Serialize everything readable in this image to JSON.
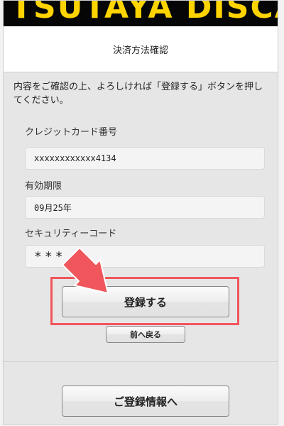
{
  "header": {
    "logo_text": "TSUTAYA DISCAS",
    "page_title": "決済方法確認"
  },
  "notice": "内容をご確認の上、よろしければ「登録する」ボタンを押してください。",
  "form": {
    "card_number_label": "クレジットカード番号",
    "card_number_value": "xxxxxxxxxxxx4134",
    "expiry_label": "有効期限",
    "expiry_value": "09月25年",
    "security_code_label": "セキュリティーコード",
    "security_code_value": "***"
  },
  "buttons": {
    "register": "登録する",
    "back": "前へ戻る",
    "registration_info": "ご登録情報へ"
  },
  "annotation": {
    "highlight_color": "#f0565b",
    "arrow_color": "#f0565b"
  }
}
